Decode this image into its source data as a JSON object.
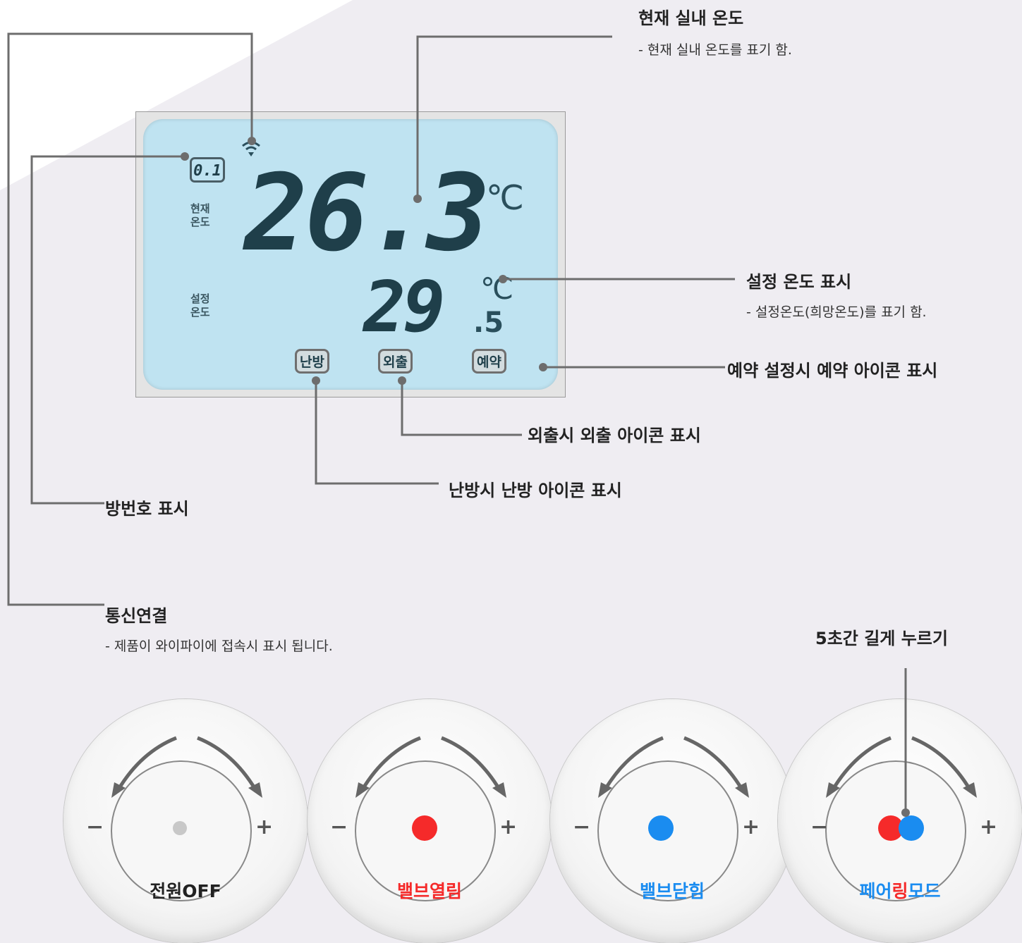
{
  "lcd": {
    "room_number": "0.1",
    "current_label_line1": "현재",
    "current_label_line2": "온도",
    "set_label_line1": "설정",
    "set_label_line2": "온도",
    "current_temp": "26.3",
    "set_temp_int": "29",
    "set_temp_dec": ".5",
    "unit": "℃",
    "icon_heating": "난방",
    "icon_away": "외출",
    "icon_reserve": "예약"
  },
  "callouts": {
    "current_title": "현재 실내 온도",
    "current_desc": "- 현재 실내 온도를 표기 함.",
    "set_title": "설정 온도 표시",
    "set_desc": "- 설정온도(희망온도)를 표기 함.",
    "reserve": "예약 설정시 예약 아이콘 표시",
    "away": "외출시 외출 아이콘 표시",
    "heating": "난방시 난방 아이콘 표시",
    "room": "방번호 표시",
    "comm_title": "통신연결",
    "comm_desc": "- 제품이 와이파이에 접속시 표시 됩니다.",
    "long_press": "5초간 길게 누르기"
  },
  "dials": [
    {
      "caption_a": "전원",
      "caption_b": "OFF",
      "color_a": "#222222",
      "color_b": "#222222",
      "minus": "−",
      "plus": "+"
    },
    {
      "caption_a": "밸브열림",
      "caption_b": "",
      "color_a": "#f52a2a",
      "color_b": "#f52a2a",
      "minus": "−",
      "plus": "+"
    },
    {
      "caption_a": "밸브닫힘",
      "caption_b": "",
      "color_a": "#1a8cf0",
      "color_b": "#1a8cf0",
      "minus": "−",
      "plus": "+"
    },
    {
      "caption_a": "페어",
      "caption_b": "링",
      "caption_c": "모드",
      "color_a": "#1a8cf0",
      "color_b": "#f52a2a",
      "minus": "−",
      "plus": "+"
    }
  ],
  "colors": {
    "red": "#f52a2a",
    "blue": "#1a8cf0",
    "gray_dot": "#c8c8c8",
    "leader": "#6d6d6d"
  }
}
